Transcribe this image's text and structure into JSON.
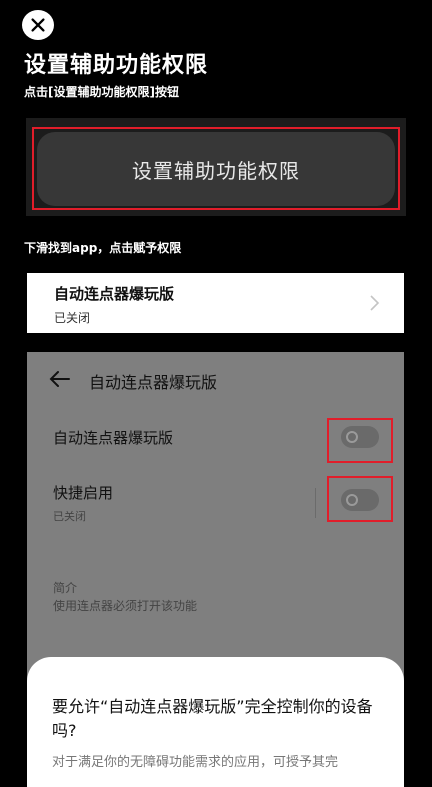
{
  "header": {
    "title": "设置辅助功能权限",
    "subtitle": "点击[设置辅助功能权限]按钮"
  },
  "setup_button_label": "设置辅助功能权限",
  "hint": "下滑找到app，点击赋予权限",
  "app_card": {
    "name": "自动连点器爆玩版",
    "status": "已关闭"
  },
  "settings_panel": {
    "title": "自动连点器爆玩版",
    "rows": [
      {
        "label": "自动连点器爆玩版"
      },
      {
        "label": "快捷启用",
        "sub": "已关闭"
      }
    ],
    "intro_label": "简介",
    "intro_text": "使用连点器必须打开该功能"
  },
  "dialog": {
    "question": "要允许“自动连点器爆玩版”完全控制你的设备吗?",
    "description": "对于满足你的无障碍功能需求的应用，可授予其完"
  },
  "icons": {
    "close": "close-icon",
    "chevron": "chevron-right-icon",
    "back": "back-arrow-icon"
  },
  "colors": {
    "highlight": "#e11d2a"
  }
}
